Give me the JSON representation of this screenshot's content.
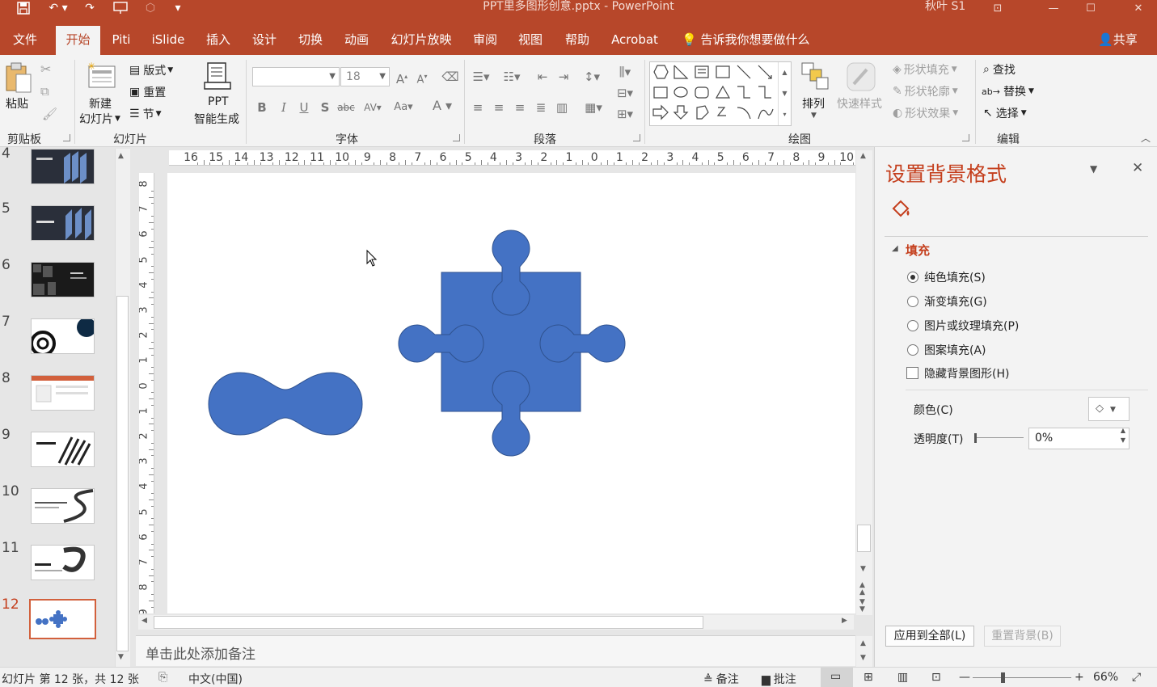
{
  "titlebar": {
    "title": "PPT里多图形创意.pptx  -  PowerPoint",
    "user": "秋叶 S1",
    "save_icon": "save-icon",
    "undo_icon": "undo-icon",
    "redo_icon": "redo-icon"
  },
  "tabs": [
    {
      "label": "文件",
      "active": false
    },
    {
      "label": "开始",
      "active": true
    },
    {
      "label": "Piti",
      "active": false
    },
    {
      "label": "iSlide",
      "active": false
    },
    {
      "label": "插入",
      "active": false
    },
    {
      "label": "设计",
      "active": false
    },
    {
      "label": "切换",
      "active": false
    },
    {
      "label": "动画",
      "active": false
    },
    {
      "label": "幻灯片放映",
      "active": false
    },
    {
      "label": "审阅",
      "active": false
    },
    {
      "label": "视图",
      "active": false
    },
    {
      "label": "帮助",
      "active": false
    },
    {
      "label": "Acrobat",
      "active": false
    }
  ],
  "tellme": "告诉我你想要做什么",
  "share": "共享",
  "ribbon": {
    "clipboard": {
      "paste": "粘贴",
      "label": "剪贴板"
    },
    "slides": {
      "new_slide_1": "新建",
      "new_slide_2": "幻灯片",
      "layout": "版式",
      "reset": "重置",
      "section": "节",
      "label": "幻灯片"
    },
    "ppt_gen": {
      "line1": "PPT",
      "line2": "智能生成"
    },
    "font": {
      "name": "",
      "size": "18",
      "label": "字体"
    },
    "paragraph": {
      "label": "段落"
    },
    "drawing": {
      "arrange": "排列",
      "quick_styles": "快速样式",
      "fill": "形状填充",
      "outline": "形状轮廓",
      "effects": "形状效果",
      "label": "绘图"
    },
    "editing": {
      "find": "查找",
      "replace": "替换",
      "select": "选择",
      "label": "编辑"
    }
  },
  "slides": [
    {
      "num": "4"
    },
    {
      "num": "5"
    },
    {
      "num": "6"
    },
    {
      "num": "7"
    },
    {
      "num": "8"
    },
    {
      "num": "9"
    },
    {
      "num": "10"
    },
    {
      "num": "11"
    },
    {
      "num": "12"
    }
  ],
  "ruler": {
    "h_labels": [
      "16",
      "15",
      "14",
      "13",
      "12",
      "11",
      "10",
      "9",
      "8",
      "7",
      "6",
      "5",
      "4",
      "3",
      "2",
      "1",
      "0",
      "1",
      "2",
      "3",
      "4",
      "5",
      "6",
      "7",
      "8",
      "9",
      "10"
    ],
    "v_labels": [
      "8",
      "7",
      "6",
      "5",
      "4",
      "3",
      "2",
      "1",
      "0",
      "1",
      "2",
      "3",
      "4",
      "5",
      "6",
      "7",
      "8",
      "9"
    ]
  },
  "notes_placeholder": "单击此处添加备注",
  "pane": {
    "title": "设置背景格式",
    "section": "填充",
    "options": [
      {
        "label": "纯色填充(S)",
        "selected": true
      },
      {
        "label": "渐变填充(G)",
        "selected": false
      },
      {
        "label": "图片或纹理填充(P)",
        "selected": false
      },
      {
        "label": "图案填充(A)",
        "selected": false
      }
    ],
    "hide_bg": "隐藏背景图形(H)",
    "color_label": "颜色(C)",
    "transparency_label": "透明度(T)",
    "transparency_value": "0%",
    "apply_all": "应用到全部(L)",
    "reset_bg": "重置背景(B)"
  },
  "status": {
    "slide_info": "幻灯片 第 12 张，共 12 张",
    "language": "中文(中国)",
    "notes": "备注",
    "comments": "批注",
    "zoom": "66%"
  },
  "colors": {
    "accent": "#b7472a",
    "shape": "#4472c4",
    "shape_stroke": "#2f528f"
  }
}
